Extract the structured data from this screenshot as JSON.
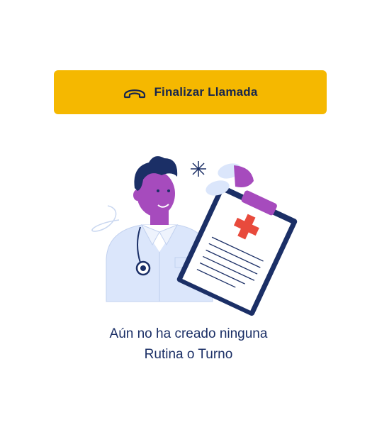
{
  "end_call_button": {
    "label": "Finalizar Llamada",
    "icon": "phone-hangup-icon",
    "color": "#F5B800"
  },
  "illustration": {
    "name": "doctor-with-clipboard"
  },
  "empty_state": {
    "line1": "Aún no ha creado ninguna",
    "line2": "Rutina o Turno"
  }
}
